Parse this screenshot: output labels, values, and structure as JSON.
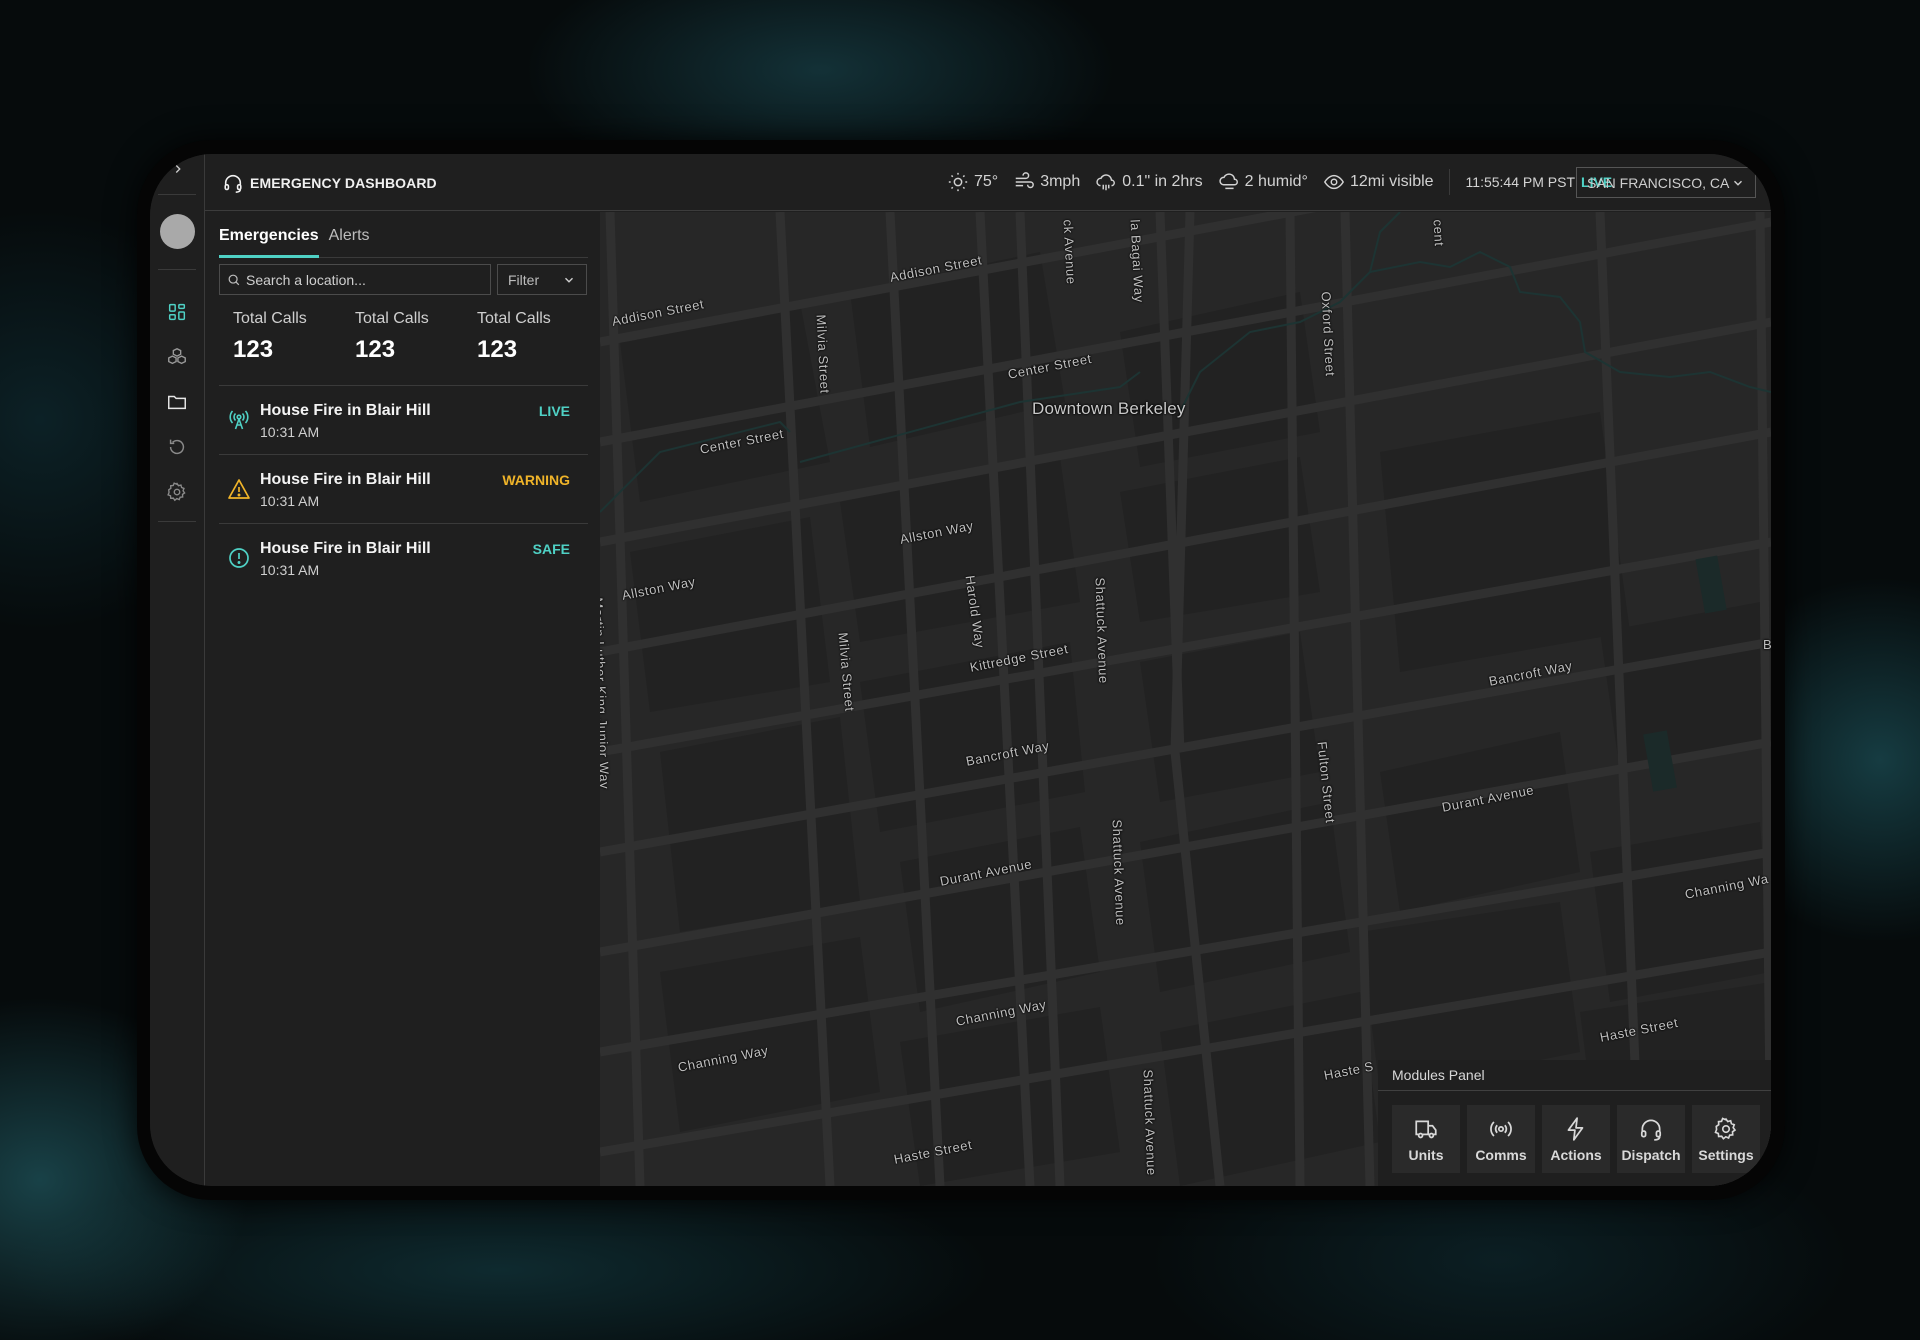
{
  "header": {
    "title": "EMERGENCY DASHBOARD",
    "weather": {
      "temperature": "75°",
      "wind": "3mph",
      "rain": "0.1\" in 2hrs",
      "humidity": "2 humid°",
      "visibility": "12mi visible"
    },
    "clock": "11:55:44 PM PST",
    "live_label": "LIVE",
    "location": "SAN FRANCISCO, CA"
  },
  "sidebar": {
    "items": [
      {
        "name": "dashboard",
        "icon": "grid-icon",
        "active": true
      },
      {
        "name": "modules",
        "icon": "boxes-icon"
      },
      {
        "name": "files",
        "icon": "folder-icon"
      },
      {
        "name": "history",
        "icon": "history-icon"
      },
      {
        "name": "settings",
        "icon": "gear-icon"
      }
    ]
  },
  "panel": {
    "tabs": [
      {
        "label": "Emergencies",
        "active": true
      },
      {
        "label": "Alerts",
        "active": false
      }
    ],
    "search": {
      "placeholder": "Search a location...",
      "value": ""
    },
    "filter_label": "Filter",
    "stats": [
      {
        "label": "Total Calls",
        "value": "123"
      },
      {
        "label": "Total Calls",
        "value": "123"
      },
      {
        "label": "Total Calls",
        "value": "123"
      }
    ],
    "emergencies": [
      {
        "title": "House Fire in Blair Hill",
        "time": "10:31 AM",
        "status": "LIVE",
        "icon": "broadcast-tower-icon",
        "color": "#4fd1c5"
      },
      {
        "title": "House Fire in Blair Hill",
        "time": "10:31 AM",
        "status": "WARNING",
        "icon": "warning-triangle-icon",
        "color": "#f0b429"
      },
      {
        "title": "House Fire in Blair Hill",
        "time": "10:31 AM",
        "status": "SAFE",
        "icon": "alert-circle-icon",
        "color": "#4fd1c5"
      }
    ]
  },
  "map": {
    "area_label": "Downtown Berkeley",
    "streets": [
      "Addison Street",
      "Addison Street",
      "Milvia Street",
      "Center Street",
      "Center Street",
      "ck Avenue",
      "la Bagai Way",
      "Oxford Street",
      "cent",
      "Allston Way",
      "Allston Way",
      "Harold Way",
      "Milvia Street",
      "Kittredge Street",
      "Shattuck Avenue",
      "Martin Luther King Junior Way",
      "Bancroft Way",
      "Bancroft Way",
      "Fulton Street",
      "Durant Avenue",
      "Durant Avenue",
      "Shattuck Avenue",
      "Channing Way",
      "Channing Way",
      "Channing Wa",
      "Haste Street",
      "Haste Street",
      "Haste S",
      "Shattuck Avenue",
      "B"
    ]
  },
  "modules": {
    "title": "Modules Panel",
    "items": [
      {
        "label": "Units",
        "icon": "truck-icon"
      },
      {
        "label": "Comms",
        "icon": "broadcast-icon"
      },
      {
        "label": "Actions",
        "icon": "lightning-icon"
      },
      {
        "label": "Dispatch",
        "icon": "headset-icon"
      },
      {
        "label": "Settings",
        "icon": "gear-icon"
      }
    ]
  },
  "colors": {
    "accent": "#4fd1c5",
    "warning": "#f0b429",
    "surface": "#1f1f1f",
    "map_base": "#272727"
  }
}
